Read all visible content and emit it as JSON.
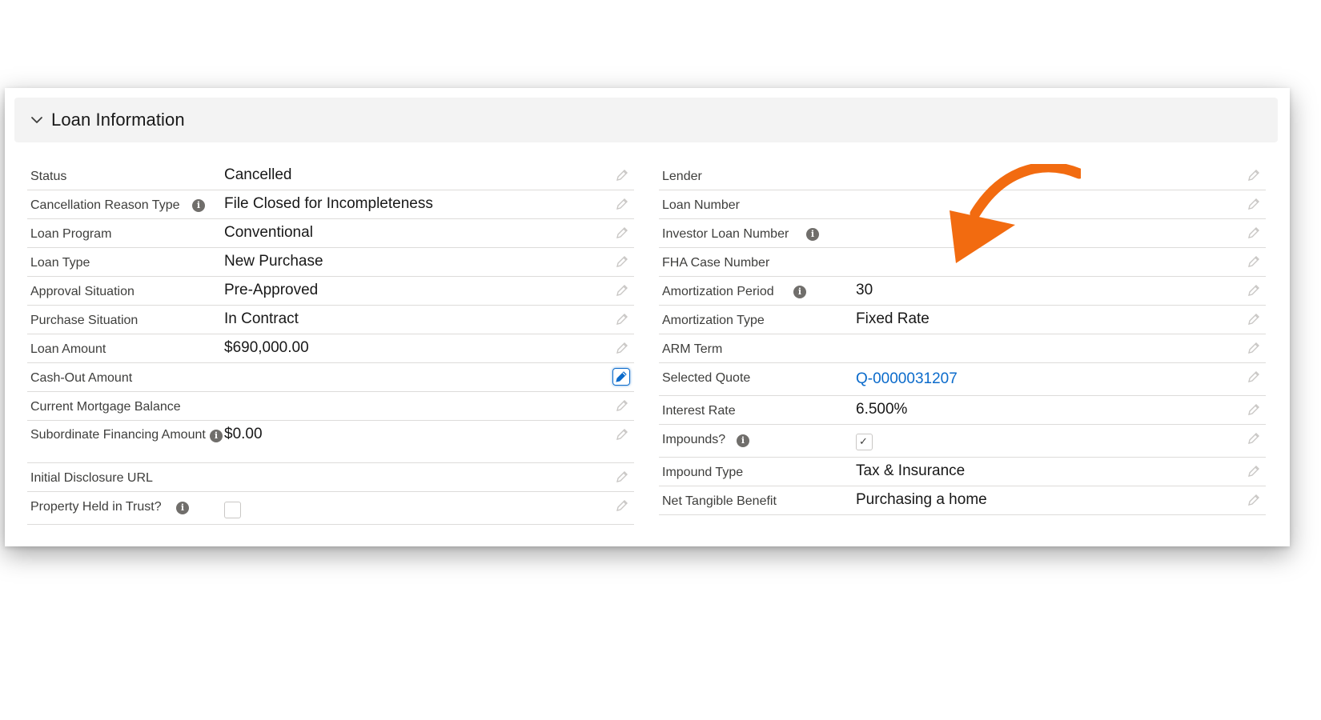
{
  "section": {
    "title": "Loan Information"
  },
  "left_fields": [
    {
      "label": "Status",
      "value": "Cancelled"
    },
    {
      "label": "Cancellation Reason Type",
      "value": "File Closed for Incompleteness"
    },
    {
      "label": "Loan Program",
      "value": "Conventional"
    },
    {
      "label": "Loan Type",
      "value": "New Purchase"
    },
    {
      "label": "Approval Situation",
      "value": "Pre-Approved"
    },
    {
      "label": "Purchase Situation",
      "value": "In Contract"
    },
    {
      "label": "Loan Amount",
      "value": "$690,000.00"
    },
    {
      "label": "Cash-Out Amount",
      "value": ""
    },
    {
      "label": "Current Mortgage Balance",
      "value": ""
    },
    {
      "label": "Subordinate Financing Amount",
      "value": "$0.00"
    },
    {
      "label": "Initial Disclosure URL",
      "value": ""
    },
    {
      "label": "Property Held in Trust?",
      "value": ""
    }
  ],
  "right_fields": [
    {
      "label": "Lender",
      "value": ""
    },
    {
      "label": "Loan Number",
      "value": ""
    },
    {
      "label": "Investor Loan Number",
      "value": ""
    },
    {
      "label": "FHA Case Number",
      "value": ""
    },
    {
      "label": "Amortization Period",
      "value": "30"
    },
    {
      "label": "Amortization Type",
      "value": "Fixed Rate"
    },
    {
      "label": "ARM Term",
      "value": ""
    },
    {
      "label": "Selected Quote",
      "value": "Q-0000031207"
    },
    {
      "label": "Interest Rate",
      "value": "6.500%"
    },
    {
      "label": "Impounds?",
      "value": ""
    },
    {
      "label": "Impound Type",
      "value": "Tax & Insurance"
    },
    {
      "label": "Net Tangible Benefit",
      "value": "Purchasing a home"
    }
  ],
  "checkboxes": {
    "property_held_in_trust": false,
    "impounds": true
  },
  "colors": {
    "accent_link": "#0b6bcb",
    "arrow": "#f26b10",
    "header_bg": "#f3f3f3"
  },
  "icons": {
    "section_toggle": "chevron-down-icon",
    "info": "info-icon",
    "edit": "pencil-icon",
    "annotation": "curved-arrow-icon"
  }
}
